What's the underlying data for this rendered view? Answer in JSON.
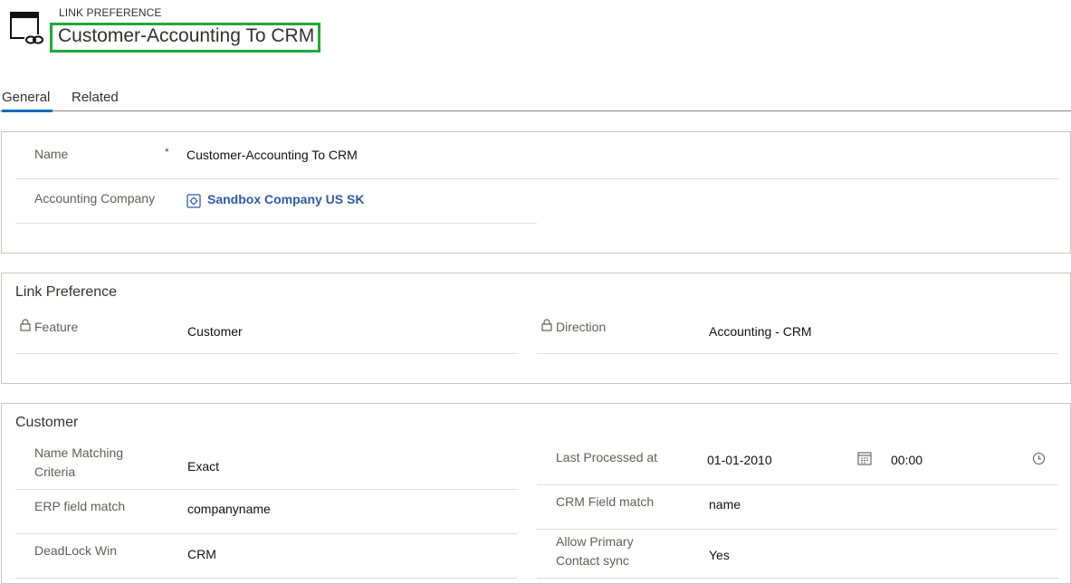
{
  "header": {
    "entity_type": "LINK PREFERENCE",
    "title": "Customer-Accounting To CRM"
  },
  "tabs": [
    {
      "label": "General",
      "active": true
    },
    {
      "label": "Related",
      "active": false
    }
  ],
  "general_section": {
    "name_label": "Name",
    "name_required_marker": "*",
    "name_value": "Customer-Accounting To CRM",
    "company_label": "Accounting Company",
    "company_value": "Sandbox Company US SK"
  },
  "link_preference_section": {
    "title": "Link Preference",
    "feature_label": "Feature",
    "feature_value": "Customer",
    "direction_label": "Direction",
    "direction_value": "Accounting - CRM"
  },
  "customer_section": {
    "title": "Customer",
    "name_matching_label_line1": "Name Matching",
    "name_matching_label_line2": "Criteria",
    "name_matching_value": "Exact",
    "erp_field_label": "ERP field match",
    "erp_field_value": "companyname",
    "deadlock_label": "DeadLock Win",
    "deadlock_value": "CRM",
    "last_processed_label": "Last Processed at",
    "last_processed_date": "01-01-2010",
    "last_processed_time": "00:00",
    "crm_field_label": "CRM Field match",
    "crm_field_value": "name",
    "allow_primary_label_line1": "Allow Primary",
    "allow_primary_label_line2": "Contact sync",
    "allow_primary_value": "Yes"
  },
  "colors": {
    "accent": "#0f6cbd",
    "highlight_box": "#22a93a",
    "link": "#2e5aa3",
    "required": "#a4262c"
  }
}
